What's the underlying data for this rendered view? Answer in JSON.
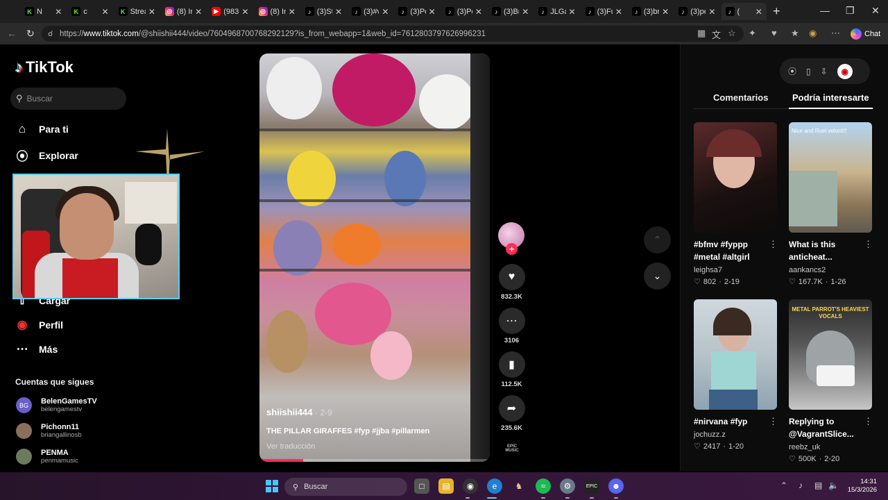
{
  "browser": {
    "tabs": [
      {
        "title": "N",
        "icon": "kick"
      },
      {
        "title": "c",
        "icon": "kick"
      },
      {
        "title": "Strea",
        "icon": "kick"
      },
      {
        "title": "(8) In",
        "icon": "instagram"
      },
      {
        "title": "(983",
        "icon": "youtube"
      },
      {
        "title": "(8) In",
        "icon": "instagram"
      },
      {
        "title": "(3)St",
        "icon": "tiktok"
      },
      {
        "title": "(3)#v",
        "icon": "tiktok"
      },
      {
        "title": "(3)Pe",
        "icon": "tiktok"
      },
      {
        "title": "(3)Pe",
        "icon": "tiktok"
      },
      {
        "title": "(3)Br",
        "icon": "tiktok"
      },
      {
        "title": "JLGa",
        "icon": "tiktok"
      },
      {
        "title": "(3)Fu",
        "icon": "tiktok"
      },
      {
        "title": "(3)br",
        "icon": "tiktok"
      },
      {
        "title": "(3)pe",
        "icon": "tiktok"
      },
      {
        "title": "(",
        "icon": "tiktok"
      }
    ],
    "url_prefix": "https://",
    "url_host": "www.tiktok.com",
    "url_path": "/@shiishii444/video/7604968700768292129?is_from_webapp=1&web_id=7612803797626996231",
    "chat_label": "Chat"
  },
  "sidebar": {
    "brand": "TikTok",
    "search_placeholder": "Buscar",
    "nav": [
      {
        "label": "Para ti",
        "icon": "home-icon"
      },
      {
        "label": "Explorar",
        "icon": "compass-icon"
      },
      {
        "label": "Cargar",
        "icon": "upload-icon"
      },
      {
        "label": "Perfil",
        "icon": "profile-icon"
      },
      {
        "label": "Más",
        "icon": "more-icon"
      }
    ],
    "following_header": "Cuentas que sigues",
    "following": [
      {
        "name": "BelenGamesTV",
        "handle": "belengamestv",
        "initials": "BG"
      },
      {
        "name": "Pichonn11",
        "handle": "briangallinosb",
        "initials": ""
      },
      {
        "name": "PENMA",
        "handle": "penmamusic",
        "initials": ""
      }
    ]
  },
  "video": {
    "author": "shiishii444",
    "date": "· 2-9",
    "caption": "THE PILLAR GIRAFFES #fyp #jjba #pillarmen",
    "translate": "Ver traducción",
    "progress": 0.19,
    "likes": "832.3K",
    "comments": "3106",
    "saves": "112.5K",
    "shares": "235.6K",
    "music_label": "EPIC MUSIC"
  },
  "right_panel": {
    "tabs": [
      "Comentarios",
      "Podría interesarte"
    ],
    "selected_tab": 1,
    "cards": [
      {
        "title": "#bfmv #fyppp #metal #altgirl",
        "author": "leighsa7",
        "likes": "802",
        "date": "2-19",
        "overlay": ""
      },
      {
        "title": "What is this anticheat...",
        "author": "aankancs2",
        "likes": "167.7K",
        "date": "1-26",
        "overlay": "Nice and Ruel velocit!!"
      },
      {
        "title": "#nirvana #fyp",
        "author": "jochuzz.z",
        "likes": "2417",
        "date": "1-20",
        "overlay": ""
      },
      {
        "title": "Replying to @VagrantSlice...",
        "author": "reebz_uk",
        "likes": "500K",
        "date": "2-20",
        "overlay": "METAL PARROT'S HEAVIEST VOCALS"
      }
    ]
  },
  "taskbar": {
    "search_placeholder": "Buscar",
    "time": "14:31",
    "date": "15/3/2026"
  },
  "colors": {
    "accent": "#fe2c55",
    "cyan": "#25f4ee",
    "taskbar": "#301536"
  }
}
